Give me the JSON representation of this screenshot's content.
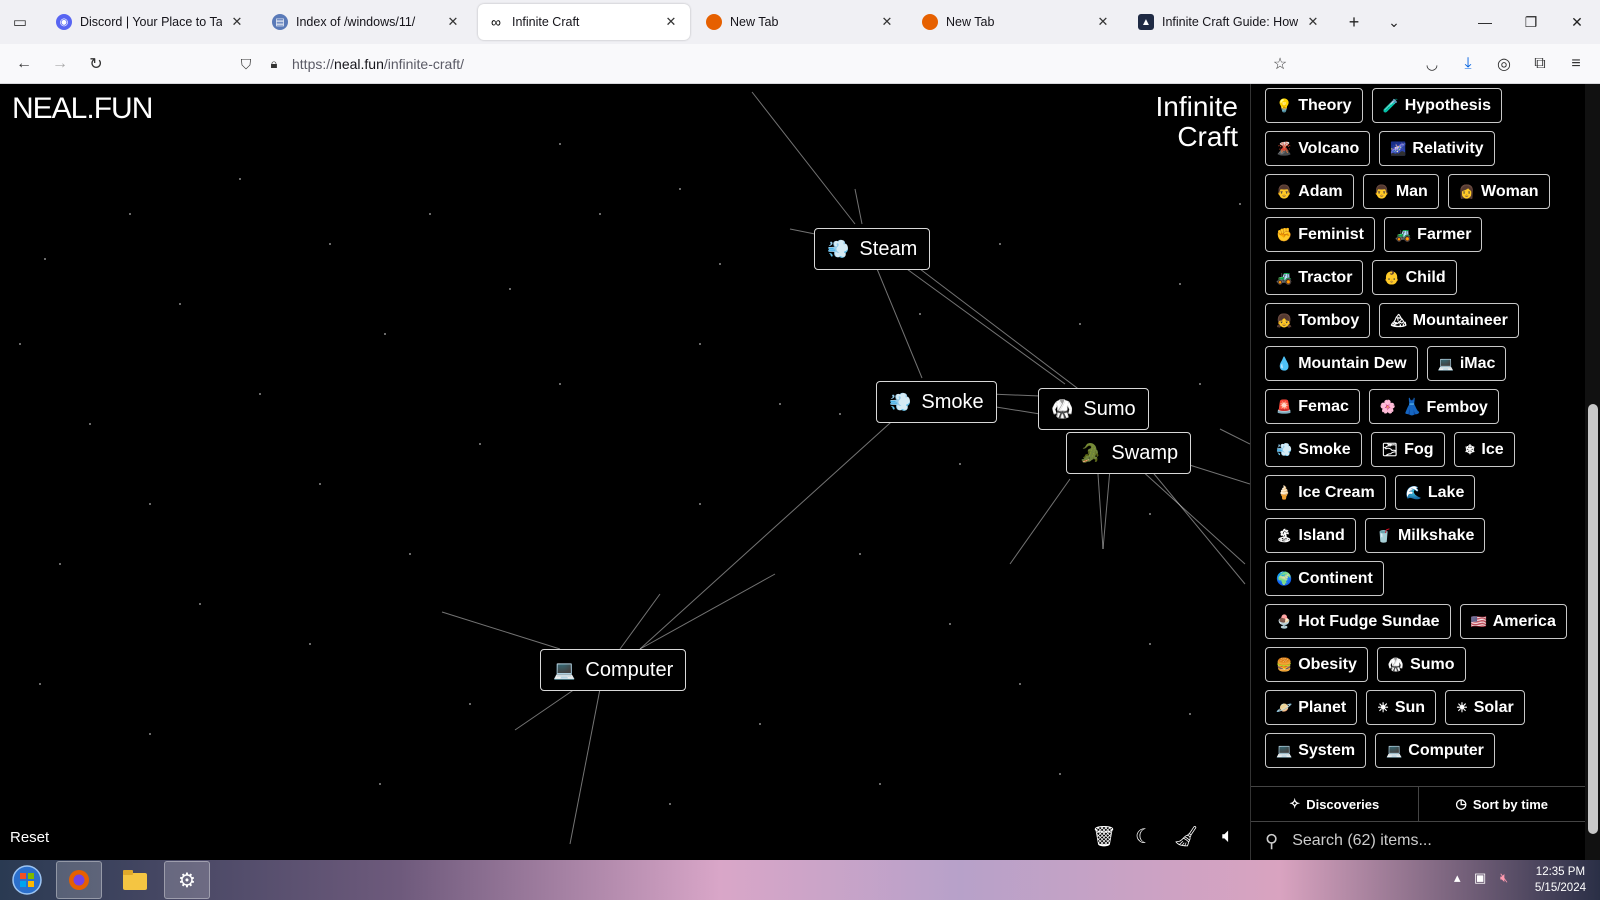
{
  "browser": {
    "tabs": [
      {
        "label": "Discord | Your Place to Talk and Hang Out",
        "favicon_color": "#5865f2",
        "favicon_glyph": "◉",
        "active": false
      },
      {
        "label": "Index of /windows/11/",
        "favicon_color": "#5a7ab8",
        "favicon_glyph": "▤",
        "active": false
      },
      {
        "label": "Infinite Craft",
        "favicon_color": "#000000",
        "favicon_glyph": "∞",
        "active": true
      },
      {
        "label": "New Tab",
        "favicon_color": "#e66000",
        "favicon_glyph": "●",
        "active": false
      },
      {
        "label": "New Tab",
        "favicon_color": "#e66000",
        "favicon_glyph": "●",
        "active": false
      },
      {
        "label": "Infinite Craft Guide: How to Make",
        "favicon_color": "#1f2a44",
        "favicon_glyph": "▲",
        "active": false
      }
    ],
    "url_prefix": "https://",
    "url_host": "neal.fun",
    "url_path": "/infinite-craft/"
  },
  "canvas": {
    "logo": "NEAL.FUN",
    "brand_line1": "Infinite",
    "brand_line2": "Craft",
    "reset_label": "Reset",
    "nodes": [
      {
        "emoji": "💨",
        "label": "Steam"
      },
      {
        "emoji": "💨",
        "label": "Smoke"
      },
      {
        "emoji": "🥋",
        "label": "Sumo"
      },
      {
        "emoji": "🐊",
        "label": "Swamp"
      },
      {
        "emoji": "💻",
        "label": "Computer"
      }
    ]
  },
  "sidebar": {
    "items": [
      [
        {
          "emoji": "💡",
          "label": "Theory"
        },
        {
          "emoji": "🧪",
          "label": "Hypothesis"
        }
      ],
      [
        {
          "emoji": "🌋",
          "label": "Volcano"
        },
        {
          "emoji": "🌌",
          "label": "Relativity"
        }
      ],
      [
        {
          "emoji": "👨",
          "label": "Adam"
        },
        {
          "emoji": "👨",
          "label": "Man"
        },
        {
          "emoji": "👩",
          "label": "Woman"
        }
      ],
      [
        {
          "emoji": "✊",
          "label": "Feminist"
        },
        {
          "emoji": "🚜",
          "label": "Farmer"
        }
      ],
      [
        {
          "emoji": "🚜",
          "label": "Tractor"
        },
        {
          "emoji": "👶",
          "label": "Child"
        }
      ],
      [
        {
          "emoji": "👧",
          "label": "Tomboy"
        },
        {
          "emoji": "🏔",
          "label": "Mountaineer"
        }
      ],
      [
        {
          "emoji": "💧",
          "label": "Mountain Dew"
        },
        {
          "emoji": "💻",
          "label": "iMac"
        }
      ],
      [
        {
          "emoji": "🚨",
          "label": "Femac"
        },
        {
          "emoji": "🌸",
          "label": "👗 Femboy"
        }
      ],
      [
        {
          "emoji": "💨",
          "label": "Smoke"
        },
        {
          "emoji": "🌫",
          "label": "Fog"
        },
        {
          "emoji": "❄",
          "label": "Ice"
        }
      ],
      [
        {
          "emoji": "🍦",
          "label": "Ice Cream"
        },
        {
          "emoji": "🌊",
          "label": "Lake"
        }
      ],
      [
        {
          "emoji": "🏝",
          "label": "Island"
        },
        {
          "emoji": "🥤",
          "label": "Milkshake"
        }
      ],
      [
        {
          "emoji": "🌍",
          "label": "Continent"
        }
      ],
      [
        {
          "emoji": "🍨",
          "label": "Hot Fudge Sundae"
        },
        {
          "emoji": "🇺🇸",
          "label": "America"
        }
      ],
      [
        {
          "emoji": "🍔",
          "label": "Obesity"
        },
        {
          "emoji": "🥋",
          "label": "Sumo"
        }
      ],
      [
        {
          "emoji": "🪐",
          "label": "Planet"
        },
        {
          "emoji": "☀",
          "label": "Sun"
        },
        {
          "emoji": "☀",
          "label": "Solar"
        }
      ],
      [
        {
          "emoji": "💻",
          "label": "System"
        },
        {
          "emoji": "💻",
          "label": "Computer"
        }
      ]
    ],
    "discoveries_label": "Discoveries",
    "sort_label": "Sort by time",
    "search_placeholder": "Search (62) items..."
  },
  "taskbar": {
    "time": "12:35 PM",
    "date": "5/15/2024"
  }
}
